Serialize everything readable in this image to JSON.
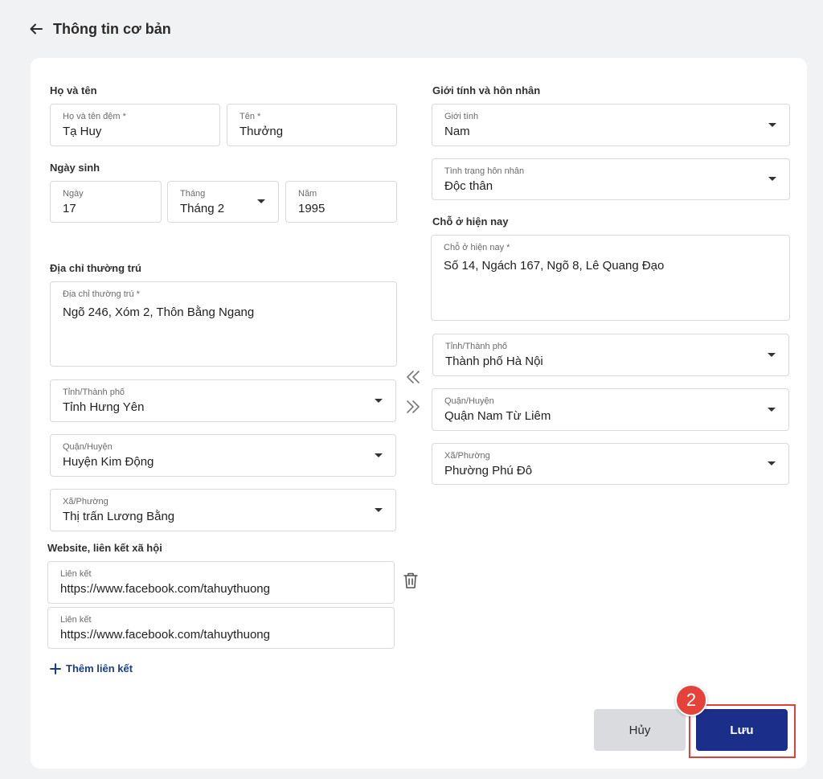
{
  "header": {
    "title": "Thông tin cơ bản"
  },
  "sections": {
    "full_name": "Họ và tên",
    "birthdate": "Ngày sinh",
    "permanent_address": "Địa chỉ thường trú",
    "gender_marital": "Giới tính và hôn nhân",
    "current_address": "Chỗ ở hiện nay",
    "website": "Website, liên kết xã hội"
  },
  "fields": {
    "middle_name": {
      "label": "Họ và tên đệm *",
      "value": "Tạ Huy"
    },
    "first_name": {
      "label": "Tên *",
      "value": "Thưởng"
    },
    "day": {
      "label": "Ngày",
      "value": "17"
    },
    "month": {
      "label": "Tháng",
      "value": "Tháng 2"
    },
    "year": {
      "label": "Năm",
      "value": "1995"
    },
    "perm_address": {
      "label": "Địa chỉ thường trú *",
      "value": "Ngõ 246, Xóm 2, Thôn Bằng Ngang"
    },
    "perm_province": {
      "label": "Tỉnh/Thành phố",
      "value": "Tỉnh Hưng Yên"
    },
    "perm_district": {
      "label": "Quận/Huyện",
      "value": "Huyện Kim Động"
    },
    "perm_ward": {
      "label": "Xã/Phường",
      "value": "Thị trấn Lương Bằng"
    },
    "gender": {
      "label": "Giới tính",
      "value": "Nam"
    },
    "marital": {
      "label": "Tình trạng hôn nhân",
      "value": "Độc thân"
    },
    "cur_address": {
      "label": "Chỗ ở hiện nay *",
      "value": "Số 14, Ngách 167, Ngõ 8, Lê Quang Đạo"
    },
    "cur_province": {
      "label": "Tỉnh/Thành phố",
      "value": "Thành phố Hà Nội"
    },
    "cur_district": {
      "label": "Quận/Huyện",
      "value": "Quận Nam Từ Liêm"
    },
    "cur_ward": {
      "label": "Xã/Phường",
      "value": "Phường Phú Đô"
    }
  },
  "links": [
    {
      "label": "Liên kết",
      "value": "https://www.facebook.com/tahuythuong"
    },
    {
      "label": "Liên kết",
      "value": "https://www.facebook.com/tahuythuong"
    }
  ],
  "add_link_label": "Thêm liên kết",
  "buttons": {
    "cancel": "Hủy",
    "save": "Lưu"
  },
  "step_badge": "2",
  "colors": {
    "primary": "#1b2f8a",
    "highlight": "#e0403a",
    "cancel_bg": "#d9dbde"
  },
  "icons": [
    "arrow-left-icon",
    "chevron-down-icon",
    "double-chevron-left-icon",
    "double-chevron-right-icon",
    "trash-icon",
    "plus-icon"
  ]
}
